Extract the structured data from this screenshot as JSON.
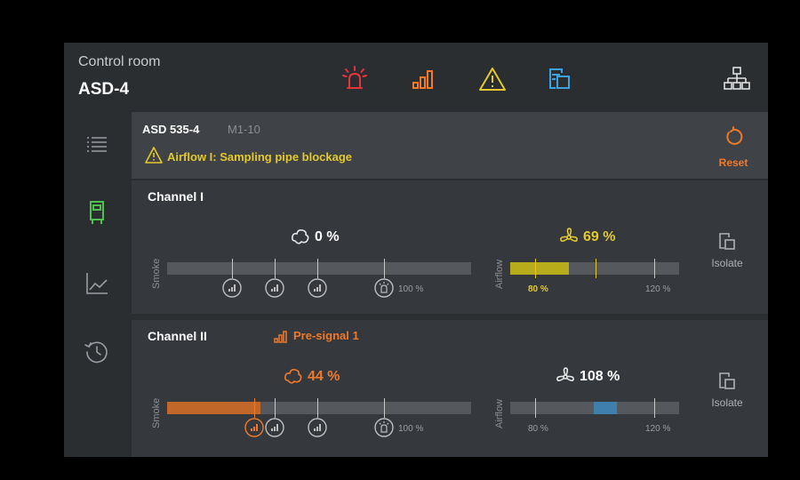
{
  "header": {
    "title": "Control room",
    "device": "ASD-4"
  },
  "alarm": {
    "device_name": "ASD 535-4",
    "module": "M1-10",
    "message": "Airflow I: Sampling pipe blockage",
    "reset_label": "Reset"
  },
  "channels": [
    {
      "name": "Channel I",
      "status": "",
      "smoke_label": "Smoke",
      "smoke_value": "0 %",
      "smoke_fill": 0,
      "smoke_max_label": "100 %",
      "airflow_label": "Airflow",
      "airflow_value": "69 %",
      "airflow_min_label": "80 %",
      "airflow_max_label": "120 %",
      "isolate_label": "Isolate"
    },
    {
      "name": "Channel II",
      "status": "Pre-signal 1",
      "smoke_label": "Smoke",
      "smoke_value": "44 %",
      "smoke_fill": 0.44,
      "smoke_max_label": "100 %",
      "airflow_label": "Airflow",
      "airflow_value": "108 %",
      "airflow_min_label": "80 %",
      "airflow_max_label": "120 %",
      "isolate_label": "Isolate"
    }
  ],
  "icons": {
    "header": [
      "fire-alarm-icon",
      "pre-signal-icon",
      "warning-icon",
      "isolate-icon",
      "network-icon"
    ],
    "sidebar": [
      "list-icon",
      "device-icon",
      "chart-icon",
      "history-icon"
    ]
  },
  "colors": {
    "fire": "#e8343a",
    "presignal": "#ef7a2b",
    "warning": "#e3c92b",
    "isolate": "#3ba3e2",
    "device": "#4ec24e",
    "airflow_blue": "#3f7fae"
  }
}
